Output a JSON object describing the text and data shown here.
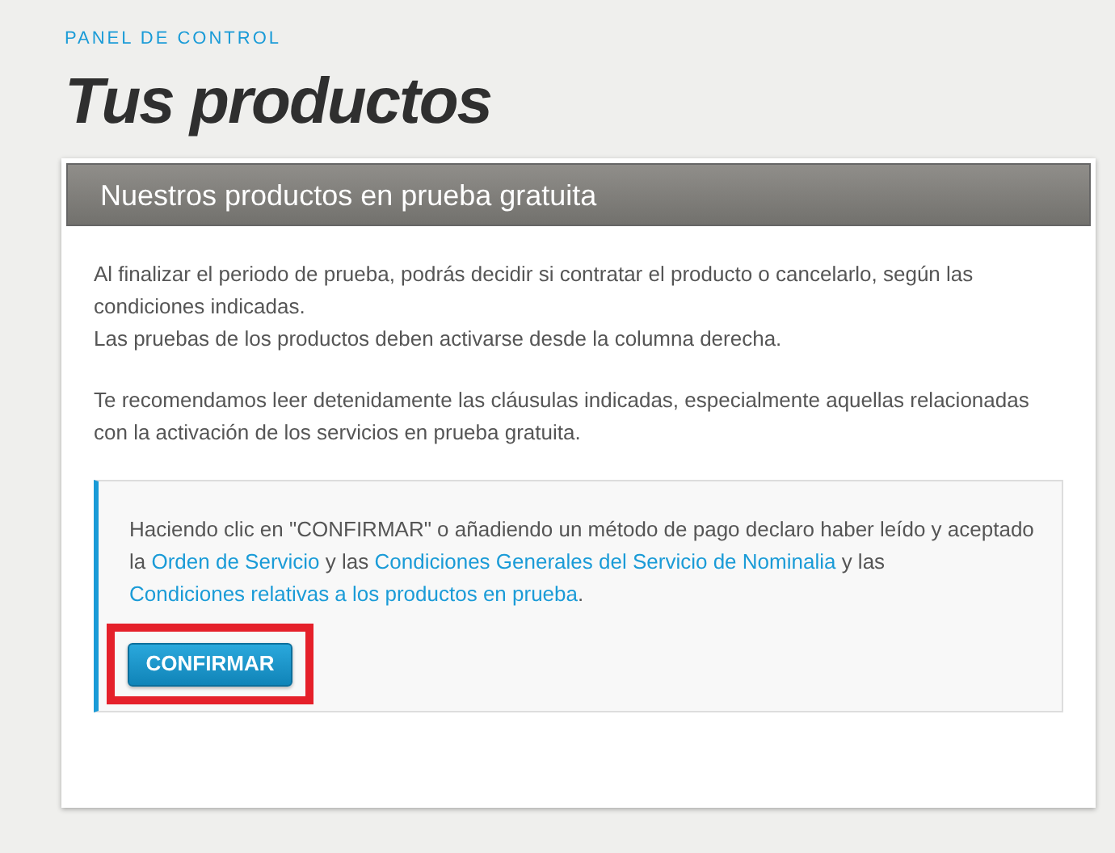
{
  "breadcrumb": "PANEL DE CONTROL",
  "title": "Tus productos",
  "panel": {
    "header": "Nuestros productos en prueba gratuita",
    "paragraphs": [
      [
        "Al finalizar el periodo de prueba, podrás decidir si contratar el producto o cancelarlo, según las condiciones indicadas.",
        "Las pruebas de los productos deben activarse desde la columna derecha."
      ],
      [
        "Te recomendamos leer detenidamente las cláusulas indicadas, especialmente aquellas relacionadas con la activación de los servicios en prueba gratuita."
      ]
    ],
    "notice": {
      "parts": [
        {
          "kind": "text",
          "text": "Haciendo clic en \"CONFIRMAR\" o añadiendo un método de pago declaro haber leído y aceptado la "
        },
        {
          "kind": "link",
          "text": "Orden de Servicio"
        },
        {
          "kind": "text",
          "text": " y las "
        },
        {
          "kind": "link",
          "text": "Condiciones Generales del Servicio de Nominalia"
        },
        {
          "kind": "text",
          "text": " y las "
        },
        {
          "kind": "link",
          "text": "Condiciones relativas a los productos en prueba"
        },
        {
          "kind": "text",
          "text": "."
        }
      ],
      "button": {
        "label": "CONFIRMAR",
        "highlighted": true
      }
    }
  }
}
